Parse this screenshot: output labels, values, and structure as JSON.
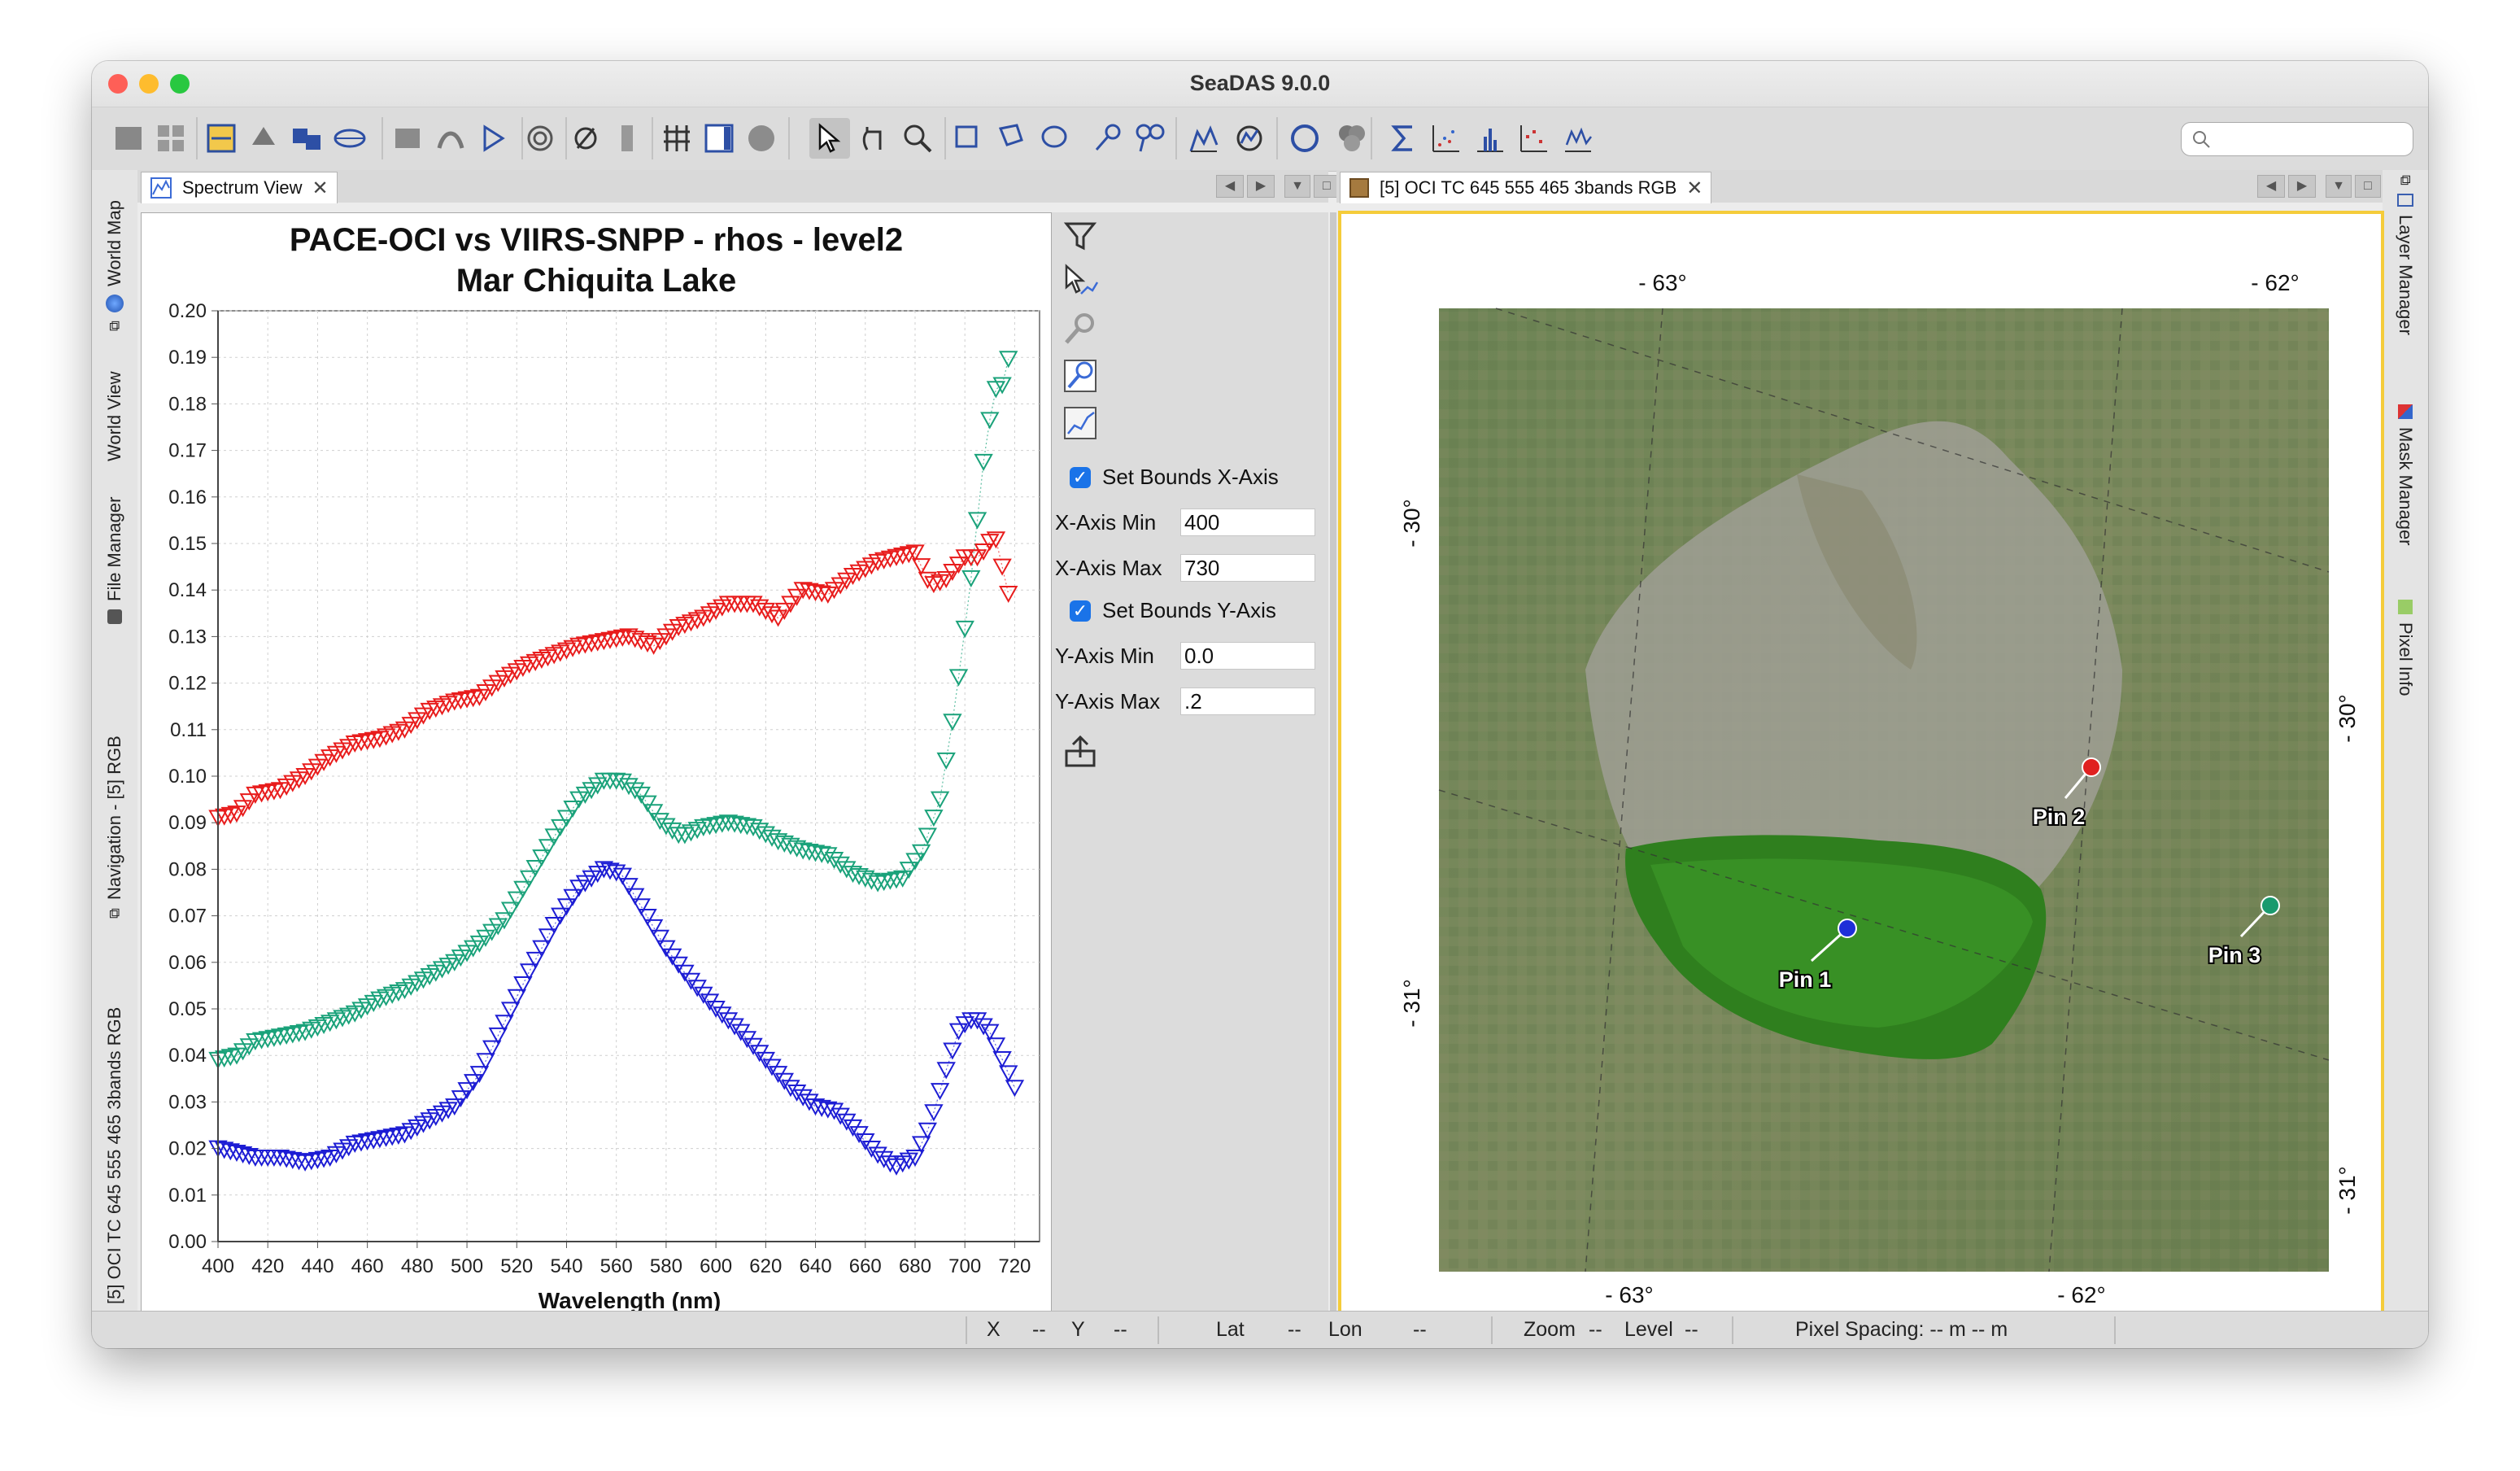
{
  "window": {
    "title": "SeaDAS 9.0.0"
  },
  "left_sidebar": [
    {
      "label": "World Map"
    },
    {
      "label": "World View"
    },
    {
      "label": "File Manager"
    },
    {
      "label": "Navigation - [5] RGB"
    },
    {
      "label": "[5] OCI TC 645 555 465 3bands RGB"
    }
  ],
  "right_sidebar": [
    {
      "label": "Layer Manager"
    },
    {
      "label": "Mask Manager"
    },
    {
      "label": "Pixel Info"
    }
  ],
  "spectrum_tab": {
    "label": "Spectrum View",
    "close": "✕"
  },
  "image_tab": {
    "label": "[5] OCI TC 645 555 465 3bands RGB",
    "close": "✕"
  },
  "tab_controls": {
    "prev": "◀",
    "next": "▶",
    "menu": "▼",
    "maximize": "□"
  },
  "chart_data": {
    "type": "scatter",
    "title": "PACE-OCI vs VIIRS-SNPP - rhos - level2",
    "subtitle": "Mar Chiquita Lake",
    "xlabel": "Wavelength (nm)",
    "ylabel": "",
    "xlim": [
      400,
      730
    ],
    "ylim": [
      0,
      0.2
    ],
    "x_ticks": [
      "400",
      "420",
      "440",
      "460",
      "480",
      "500",
      "520",
      "540",
      "560",
      "580",
      "600",
      "620",
      "640",
      "660",
      "680",
      "700",
      "720"
    ],
    "y_ticks": [
      "0.00",
      "0.01",
      "0.02",
      "0.03",
      "0.04",
      "0.05",
      "0.06",
      "0.07",
      "0.08",
      "0.09",
      "0.10",
      "0.11",
      "0.12",
      "0.13",
      "0.14",
      "0.15",
      "0.16",
      "0.17",
      "0.18",
      "0.19",
      "0.20"
    ],
    "grid": true,
    "marker": "triangle-down",
    "series": [
      {
        "color": "#e81c1c",
        "knots": [
          [
            400,
            0.091
          ],
          [
            408,
            0.092
          ],
          [
            415,
            0.096
          ],
          [
            425,
            0.097
          ],
          [
            435,
            0.1
          ],
          [
            445,
            0.104
          ],
          [
            455,
            0.107
          ],
          [
            465,
            0.108
          ],
          [
            475,
            0.11
          ],
          [
            485,
            0.114
          ],
          [
            495,
            0.116
          ],
          [
            505,
            0.117
          ],
          [
            515,
            0.121
          ],
          [
            525,
            0.124
          ],
          [
            535,
            0.126
          ],
          [
            545,
            0.128
          ],
          [
            555,
            0.129
          ],
          [
            565,
            0.13
          ],
          [
            575,
            0.128
          ],
          [
            585,
            0.132
          ],
          [
            595,
            0.134
          ],
          [
            605,
            0.137
          ],
          [
            615,
            0.137
          ],
          [
            625,
            0.134
          ],
          [
            635,
            0.14
          ],
          [
            645,
            0.139
          ],
          [
            655,
            0.143
          ],
          [
            665,
            0.146
          ],
          [
            672,
            0.147
          ],
          [
            680,
            0.148
          ],
          [
            686,
            0.141
          ],
          [
            692,
            0.142
          ],
          [
            700,
            0.147
          ],
          [
            706,
            0.147
          ],
          [
            712,
            0.152
          ],
          [
            718,
            0.138
          ]
        ]
      },
      {
        "color": "#1aa27a",
        "knots": [
          [
            400,
            0.039
          ],
          [
            408,
            0.04
          ],
          [
            415,
            0.043
          ],
          [
            425,
            0.044
          ],
          [
            435,
            0.045
          ],
          [
            445,
            0.047
          ],
          [
            455,
            0.049
          ],
          [
            465,
            0.052
          ],
          [
            475,
            0.054
          ],
          [
            485,
            0.057
          ],
          [
            495,
            0.06
          ],
          [
            505,
            0.064
          ],
          [
            515,
            0.069
          ],
          [
            525,
            0.078
          ],
          [
            535,
            0.087
          ],
          [
            545,
            0.095
          ],
          [
            555,
            0.099
          ],
          [
            562,
            0.099
          ],
          [
            570,
            0.096
          ],
          [
            578,
            0.09
          ],
          [
            586,
            0.087
          ],
          [
            595,
            0.089
          ],
          [
            605,
            0.09
          ],
          [
            615,
            0.089
          ],
          [
            625,
            0.086
          ],
          [
            635,
            0.084
          ],
          [
            645,
            0.083
          ],
          [
            655,
            0.079
          ],
          [
            665,
            0.077
          ],
          [
            675,
            0.078
          ],
          [
            683,
            0.084
          ],
          [
            690,
            0.095
          ],
          [
            696,
            0.115
          ],
          [
            702,
            0.14
          ],
          [
            708,
            0.17
          ],
          [
            712,
            0.183
          ],
          [
            715,
            0.184
          ],
          [
            719,
            0.193
          ]
        ]
      },
      {
        "color": "#1d1dd4",
        "knots": [
          [
            400,
            0.02
          ],
          [
            408,
            0.019
          ],
          [
            415,
            0.018
          ],
          [
            425,
            0.018
          ],
          [
            435,
            0.017
          ],
          [
            445,
            0.018
          ],
          [
            455,
            0.021
          ],
          [
            465,
            0.022
          ],
          [
            475,
            0.023
          ],
          [
            485,
            0.026
          ],
          [
            495,
            0.029
          ],
          [
            505,
            0.036
          ],
          [
            515,
            0.047
          ],
          [
            525,
            0.058
          ],
          [
            535,
            0.068
          ],
          [
            545,
            0.076
          ],
          [
            555,
            0.08
          ],
          [
            562,
            0.079
          ],
          [
            570,
            0.072
          ],
          [
            580,
            0.063
          ],
          [
            590,
            0.056
          ],
          [
            600,
            0.05
          ],
          [
            610,
            0.045
          ],
          [
            620,
            0.039
          ],
          [
            630,
            0.033
          ],
          [
            640,
            0.029
          ],
          [
            648,
            0.028
          ],
          [
            656,
            0.024
          ],
          [
            664,
            0.019
          ],
          [
            672,
            0.016
          ],
          [
            680,
            0.018
          ],
          [
            686,
            0.025
          ],
          [
            692,
            0.036
          ],
          [
            698,
            0.046
          ],
          [
            704,
            0.048
          ],
          [
            710,
            0.045
          ],
          [
            716,
            0.038
          ],
          [
            720,
            0.033
          ]
        ]
      }
    ]
  },
  "tools": {
    "set_bounds_x_label": "Set Bounds X-Axis",
    "x_axis_min_label": "X-Axis Min",
    "x_axis_min_value": "400",
    "x_axis_max_label": "X-Axis Max",
    "x_axis_max_value": "730",
    "set_bounds_y_label": "Set Bounds Y-Axis",
    "y_axis_min_label": "Y-Axis Min",
    "y_axis_min_value": "0.0",
    "y_axis_max_label": "Y-Axis Max",
    "y_axis_max_value": ".2",
    "check_mark": "✓"
  },
  "map": {
    "graticule": {
      "top_left": "- 63°",
      "top_right": "- 62°",
      "bottom_left": "- 63°",
      "bottom_right": "- 62°",
      "left_upper": "- 30°",
      "left_lower": "- 31°",
      "right_upper": "- 30°",
      "right_lower": "- 31°"
    },
    "pins": [
      {
        "label": "Pin 1",
        "color": "#1e2fd8"
      },
      {
        "label": "Pin 2",
        "color": "#e02020"
      },
      {
        "label": "Pin 3",
        "color": "#1a9a6e"
      }
    ]
  },
  "status": {
    "x_label": "X",
    "x_value": "--",
    "y_label": "Y",
    "y_value": "--",
    "lat_label": "Lat",
    "lat_value": "--",
    "lon_label": "Lon",
    "lon_value": "--",
    "zoom_label": "Zoom",
    "zoom_value": "--",
    "level_label": "Level",
    "level_value": "--",
    "pixel_spacing": "Pixel Spacing: -- m -- m"
  },
  "toolbar_icons": [
    "open-product-icon",
    "grid-icon",
    "band-maths-icon",
    "session-icon",
    "mosaic-icon",
    "world-view-icon",
    "collocation-icon",
    "graph-builder-icon",
    "play-icon",
    "fingerprint-icon",
    "no-data-icon",
    "column-icon",
    "graticule-icon",
    "color-table-icon",
    "sphere-icon",
    "select-tool-icon",
    "pan-tool-icon",
    "zoom-tool-icon",
    "rectangle-tool-icon",
    "polygon-tool-icon",
    "ellipse-tool-icon",
    "pin-tool-icon",
    "gcp-tool-icon",
    "profile-plot-icon",
    "spectrum-icon",
    "circle-icon",
    "layers-icon",
    "sigma-icon",
    "scatter-plot-icon",
    "histogram-icon",
    "density-plot-icon",
    "time-series-icon"
  ]
}
